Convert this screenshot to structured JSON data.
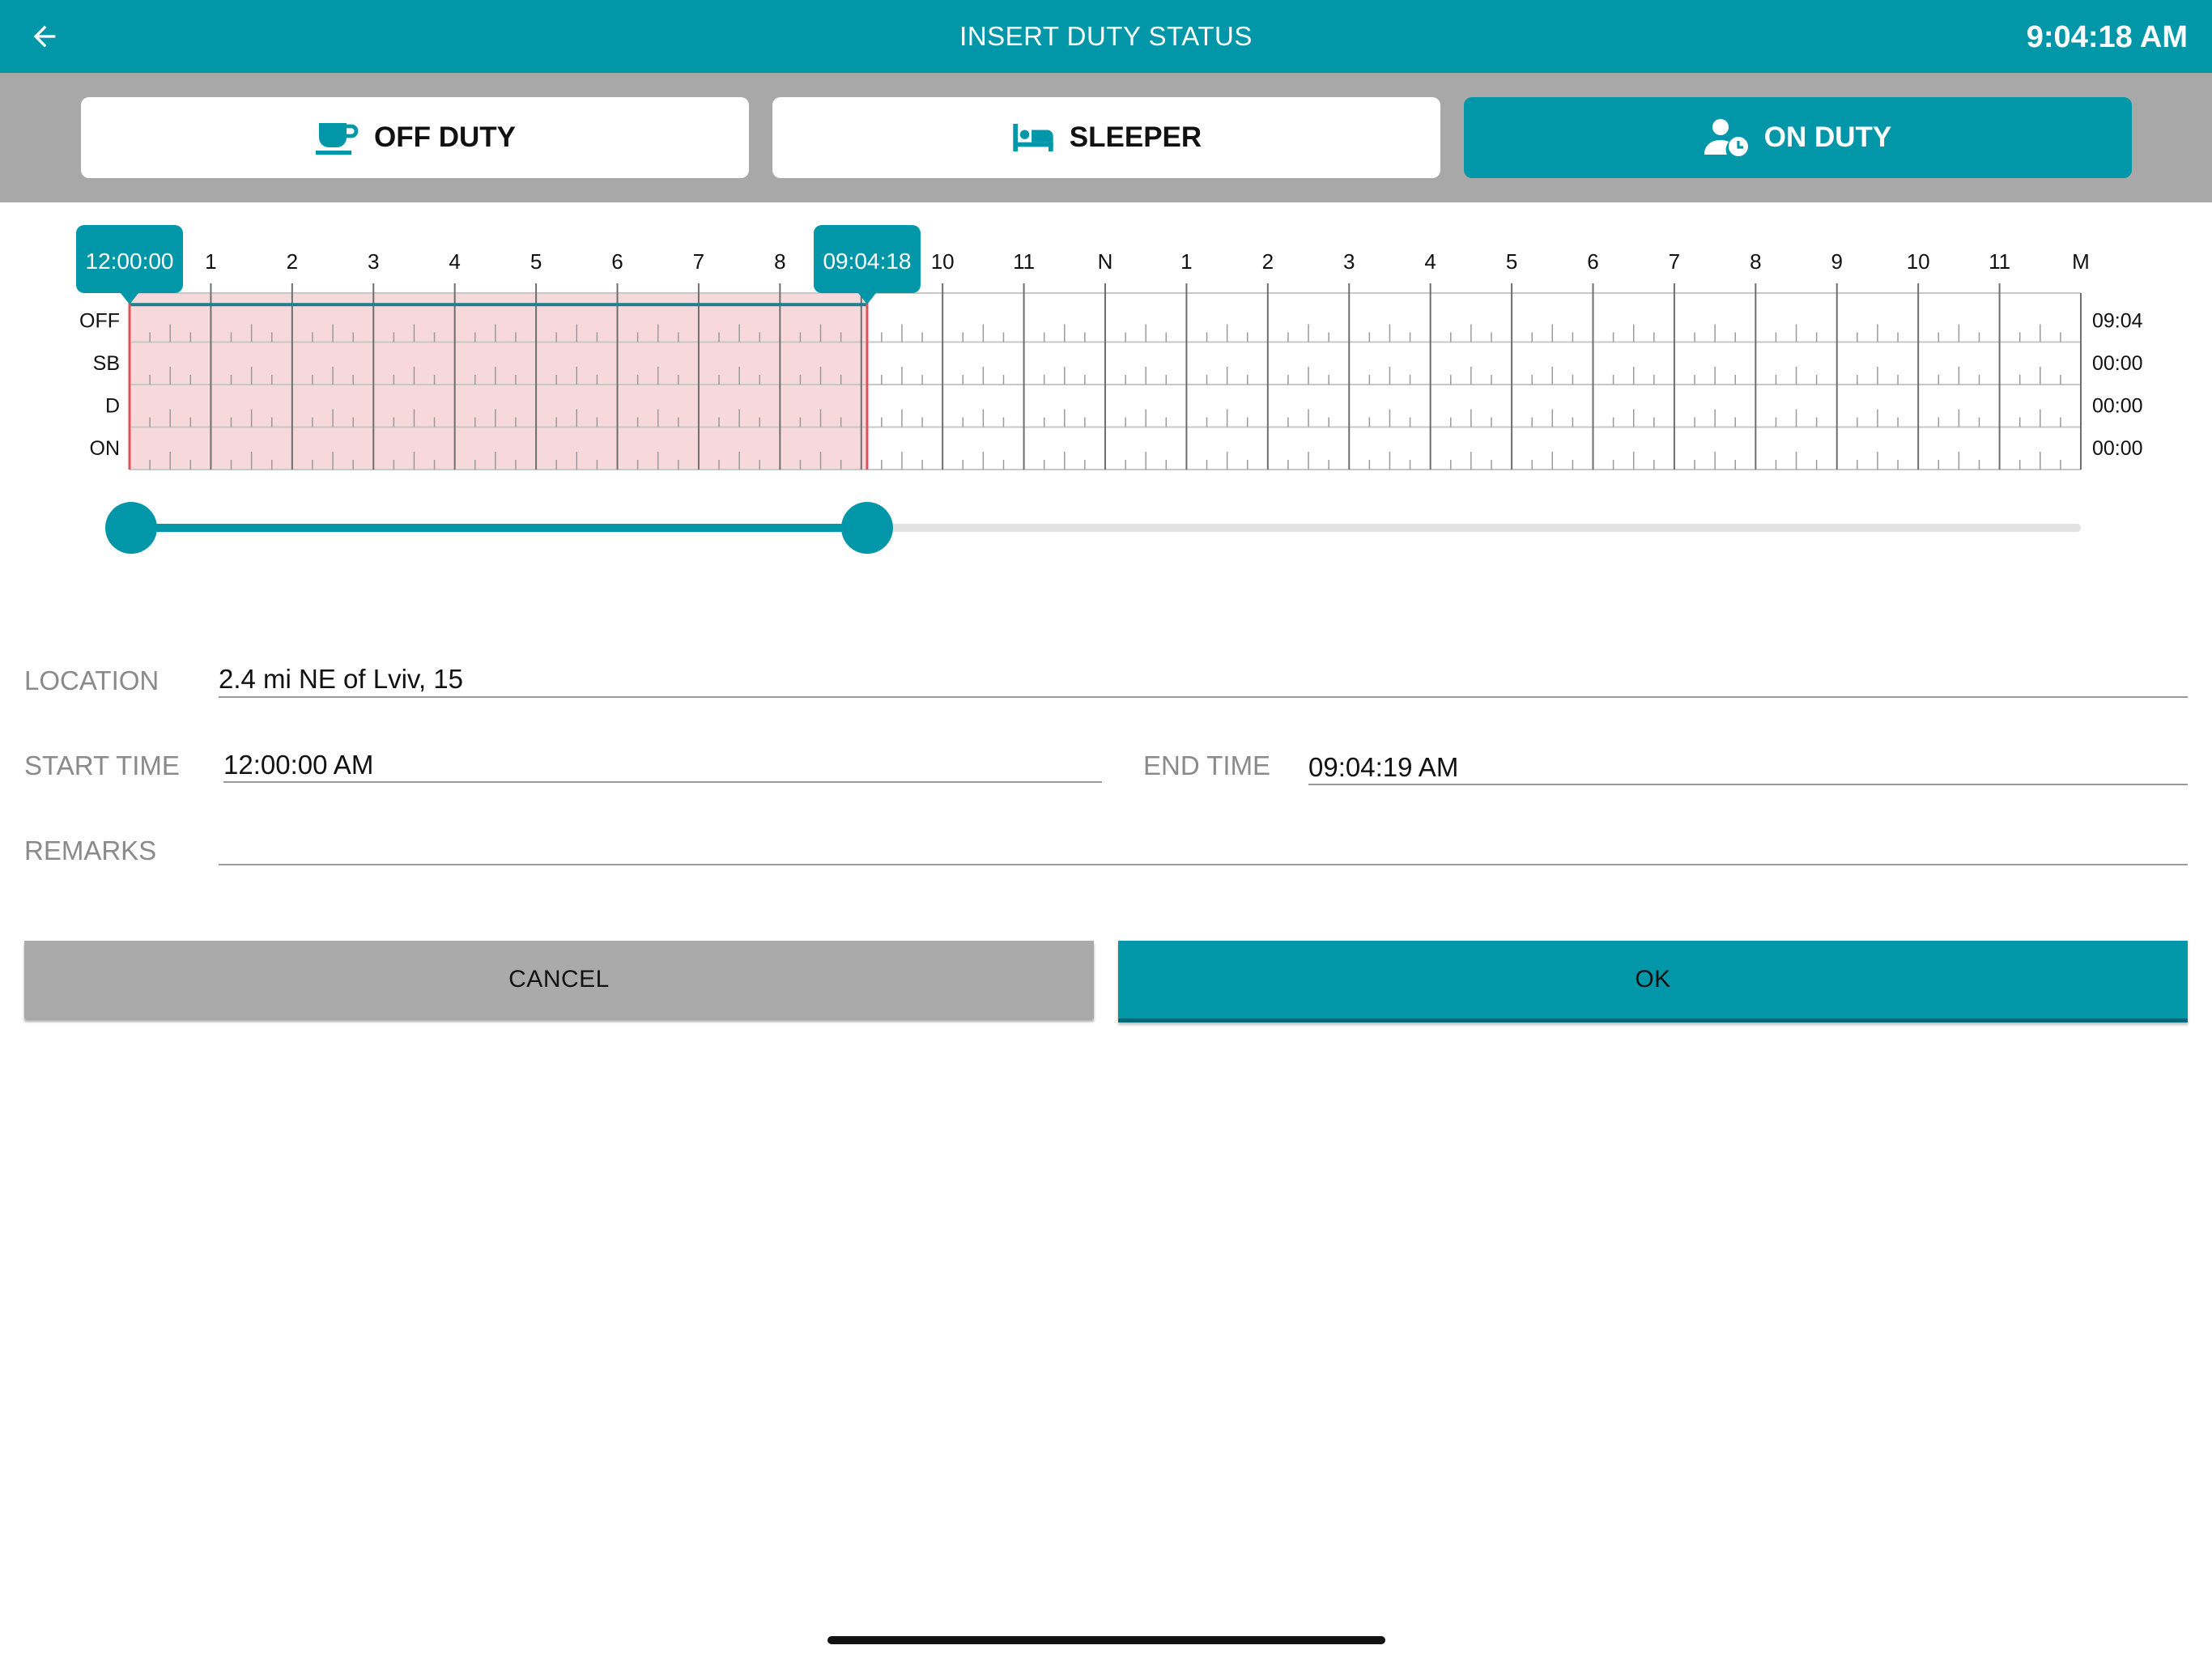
{
  "header": {
    "title": "INSERT DUTY STATUS",
    "clock": "9:04:18 AM",
    "back_icon": "arrow-left-icon"
  },
  "status_buttons": [
    {
      "label": "OFF DUTY",
      "icon": "coffee-cup-icon",
      "active": false
    },
    {
      "label": "SLEEPER",
      "icon": "bed-icon",
      "active": false
    },
    {
      "label": "ON DUTY",
      "icon": "user-clock-icon",
      "active": true
    }
  ],
  "log_graph": {
    "hour_labels": [
      "1",
      "2",
      "3",
      "4",
      "5",
      "6",
      "7",
      "8",
      "9",
      "10",
      "11",
      "N",
      "1",
      "2",
      "3",
      "4",
      "5",
      "6",
      "7",
      "8",
      "9",
      "10",
      "11",
      "M"
    ],
    "rows": [
      {
        "label": "OFF",
        "total": "09:04"
      },
      {
        "label": "SB",
        "total": "00:00"
      },
      {
        "label": "D",
        "total": "00:00"
      },
      {
        "label": "ON",
        "total": "00:00"
      }
    ],
    "selection": {
      "start_label": "12:00:00",
      "end_label": "09:04:18",
      "start_hour": 0,
      "end_hour": 9.0717
    },
    "off_duty_line": {
      "row": "OFF",
      "from_hour": 0,
      "to_hour": 9.0717
    },
    "range_slider": {
      "min_hour": 0,
      "max_hour": 24,
      "low_hour": 0,
      "high_hour": 9.0717
    }
  },
  "form": {
    "location_label": "LOCATION",
    "location_value": "2.4 mi NE of Lviv, 15",
    "start_time_label": "START TIME",
    "start_time_value": "12:00:00 AM",
    "end_time_label": "END TIME",
    "end_time_value": "09:04:19 AM",
    "remarks_label": "REMARKS",
    "remarks_value": ""
  },
  "buttons": {
    "cancel": "CANCEL",
    "ok": "OK"
  },
  "colors": {
    "accent": "#0197a8",
    "selection_fill": "#f8d9db",
    "selection_border": "#e0525a",
    "status_bar": "#a8a8a8"
  }
}
